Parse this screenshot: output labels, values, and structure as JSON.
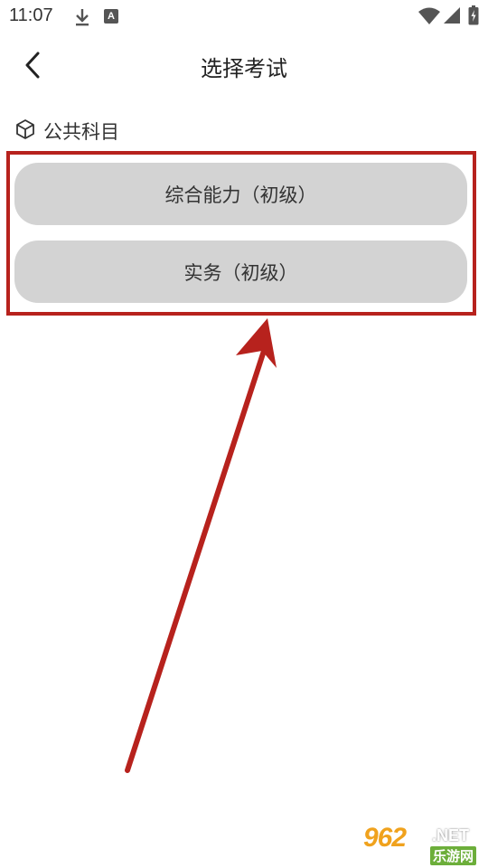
{
  "status_bar": {
    "time": "11:07",
    "icons": [
      "download-icon",
      "font-a-icon",
      "wifi-icon",
      "signal-icon",
      "battery-icon"
    ],
    "font_icon_letter": "A"
  },
  "header": {
    "back_icon": "chevron-left-icon",
    "title": "选择考试"
  },
  "section": {
    "icon": "cube-icon",
    "label": "公共科目"
  },
  "exam_options": [
    {
      "label": "综合能力（初级）"
    },
    {
      "label": "实务（初级）"
    }
  ],
  "annotation": {
    "color": "#b7221d"
  },
  "watermark": {
    "big": "962",
    "net": ".NET",
    "cn": "乐游网"
  },
  "colors": {
    "button_bg": "#d3d3d3",
    "accent_red": "#b7221d",
    "watermark_orange": "#f0a21d",
    "watermark_green": "#6cae3a"
  }
}
